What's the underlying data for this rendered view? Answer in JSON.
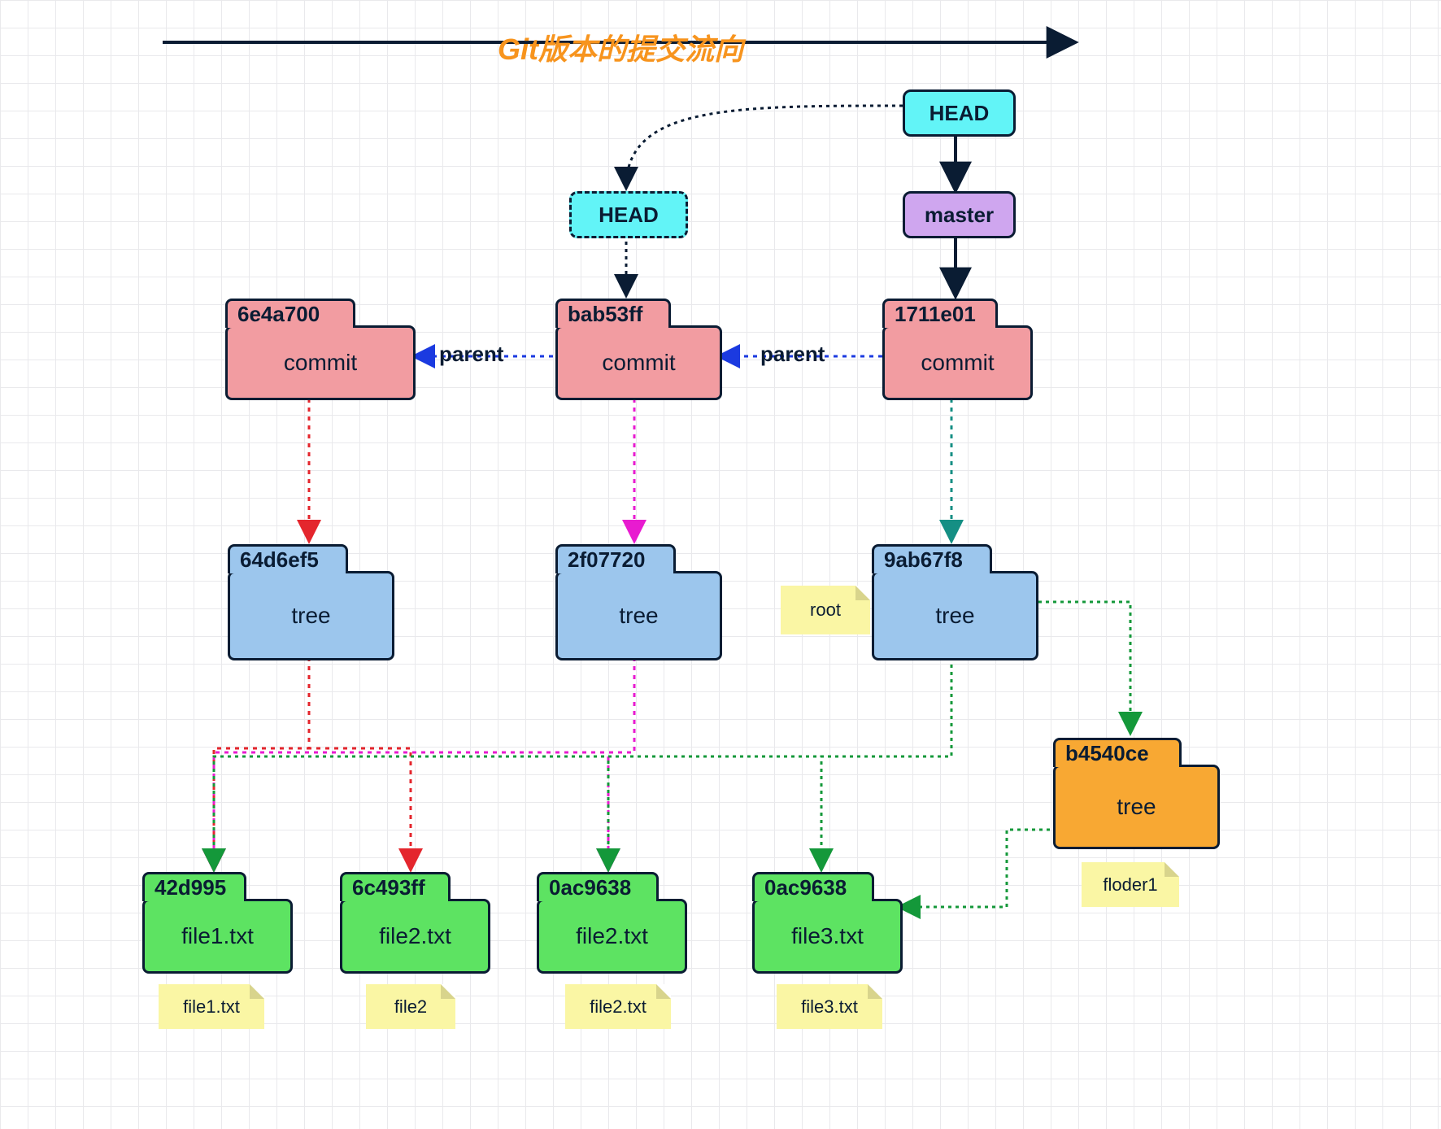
{
  "title": "Git版本的提交流向",
  "refs": {
    "head_original": "HEAD",
    "head_detached": "HEAD",
    "master": "master"
  },
  "edge_labels": {
    "parent1": "parent",
    "parent2": "parent"
  },
  "commits": [
    {
      "hash": "6e4a700",
      "label": "commit"
    },
    {
      "hash": "bab53ff",
      "label": "commit"
    },
    {
      "hash": "1711e01",
      "label": "commit"
    }
  ],
  "trees_top": [
    {
      "hash": "64d6ef5",
      "label": "tree"
    },
    {
      "hash": "2f07720",
      "label": "tree"
    },
    {
      "hash": "9ab67f8",
      "label": "tree"
    }
  ],
  "tree_sub": {
    "hash": "b4540ce",
    "label": "tree"
  },
  "blobs": [
    {
      "hash": "42d995",
      "label": "file1.txt"
    },
    {
      "hash": "6c493ff",
      "label": "file2.txt"
    },
    {
      "hash": "0ac9638",
      "label": "file2.txt"
    },
    {
      "hash": "0ac9638",
      "label": "file3.txt"
    }
  ],
  "notes": {
    "root": "root",
    "floder1": "floder1",
    "file1": "file1.txt",
    "file2": "file2",
    "file2txt": "file2.txt",
    "file3": "file3.txt"
  }
}
